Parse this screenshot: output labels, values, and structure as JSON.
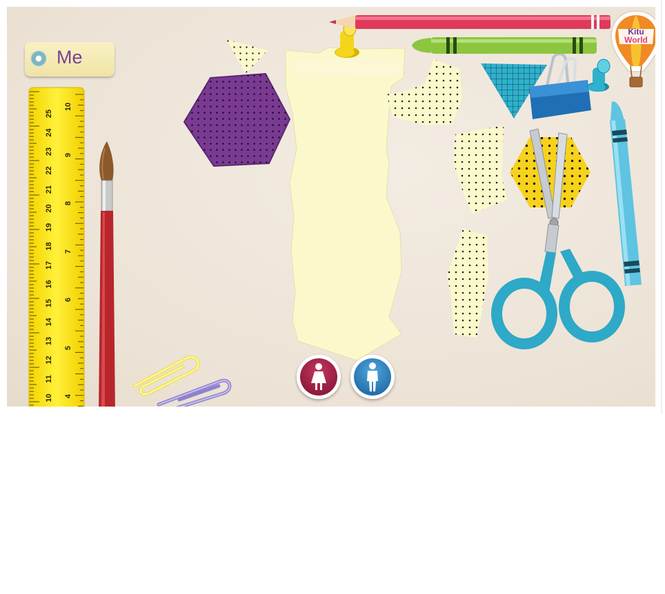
{
  "profile_tag": {
    "label": "Me"
  },
  "logo": {
    "line1": "Kitu",
    "line2": "World"
  },
  "ruler": {
    "cm_ticks": [
      "25",
      "24",
      "23",
      "22",
      "21",
      "20",
      "19",
      "18",
      "17",
      "16",
      "15",
      "14",
      "13",
      "12",
      "11",
      "10"
    ],
    "inch_ticks": [
      "10",
      "9",
      "8",
      "7",
      "6",
      "5",
      "4"
    ]
  },
  "gender_buttons": [
    {
      "name": "female",
      "icon": "female-person-icon",
      "color": "#9b1f45"
    },
    {
      "name": "male",
      "icon": "male-person-icon",
      "color": "#2b7cc0"
    }
  ],
  "colors": {
    "paper": "#fbf8cc",
    "purple_shape": "#7a3a92",
    "yellow_shape": "#f7d21b",
    "teal": "#2eb1cc",
    "pencil": "#e0395b",
    "green_crayon": "#8cc63f",
    "blue_crayon": "#5ec4e2",
    "ruler": "#ffe818"
  }
}
